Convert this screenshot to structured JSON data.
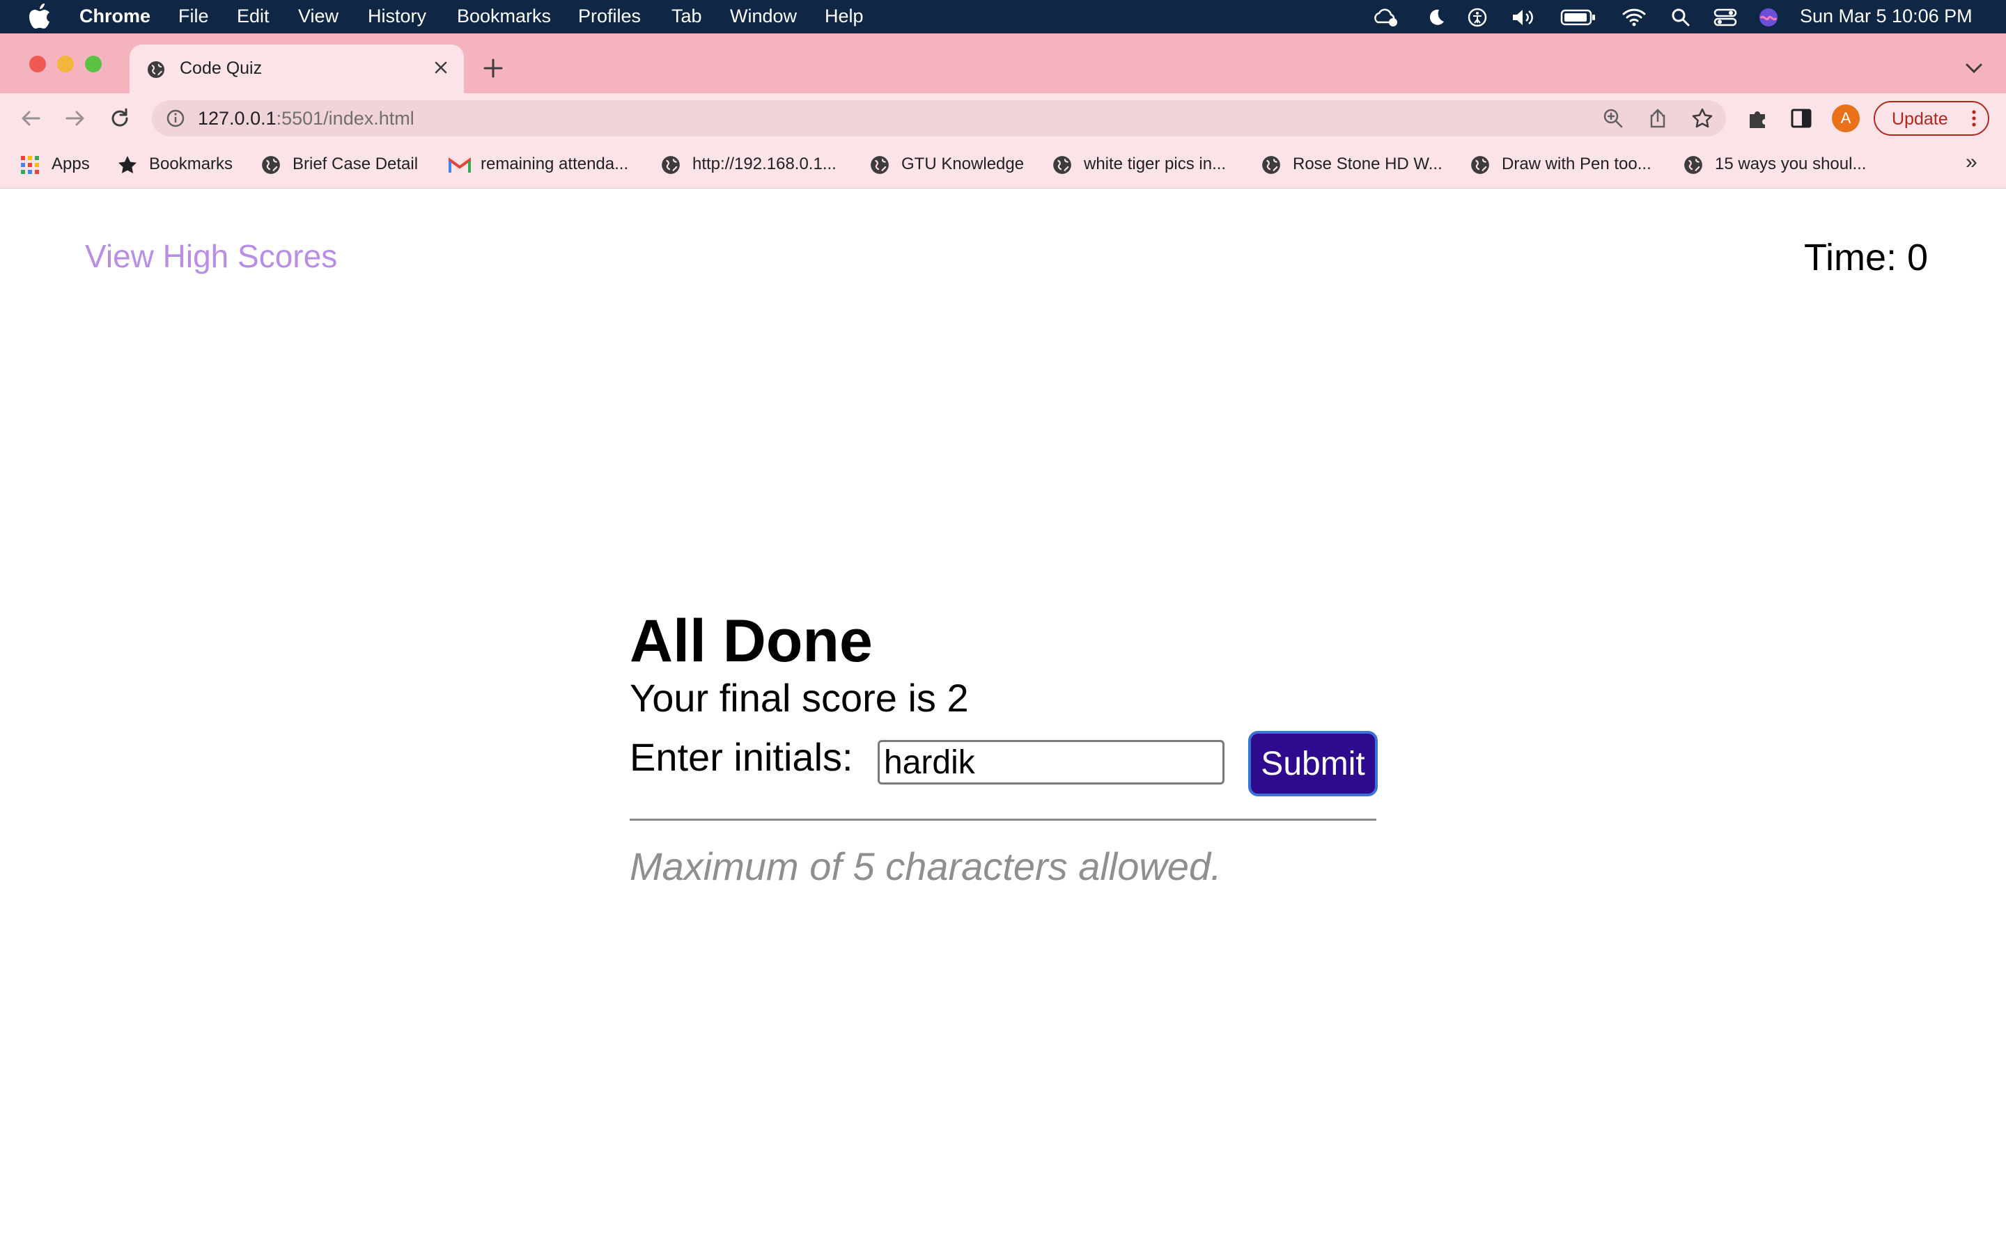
{
  "menubar": {
    "app": "Chrome",
    "items": [
      "File",
      "Edit",
      "View",
      "History",
      "Bookmarks",
      "Profiles",
      "Tab",
      "Window",
      "Help"
    ],
    "datetime": "Sun Mar 5  10:06 PM"
  },
  "browser": {
    "tab_title": "Code Quiz",
    "url_host": "127.0.0.1",
    "url_rest": ":5501/index.html",
    "avatar_letter": "A",
    "update_label": "Update",
    "bookmarks": [
      {
        "label": "Apps",
        "icon": "apps-grid-icon"
      },
      {
        "label": "Bookmarks",
        "icon": "star-icon"
      },
      {
        "label": "Brief Case Detail",
        "icon": "globe-icon"
      },
      {
        "label": "remaining attenda...",
        "icon": "gmail-icon"
      },
      {
        "label": "http://192.168.0.1...",
        "icon": "globe-icon"
      },
      {
        "label": "GTU Knowledge",
        "icon": "globe-icon"
      },
      {
        "label": "white tiger pics in...",
        "icon": "globe-icon"
      },
      {
        "label": "Rose Stone HD W...",
        "icon": "globe-icon"
      },
      {
        "label": "Draw with Pen too...",
        "icon": "globe-icon"
      },
      {
        "label": "15 ways you shoul...",
        "icon": "globe-icon"
      }
    ],
    "more_bookmarks": "»"
  },
  "page": {
    "high_scores_link": "View High Scores",
    "time_label": "Time:",
    "time_value": "0",
    "heading": "All Done",
    "score_text": "Your final score is 2",
    "initials_label": "Enter initials:",
    "initials_value": "hardik",
    "submit_label": "Submit",
    "hint": "Maximum of 5 characters allowed."
  },
  "colors": {
    "menubar": "#0f2645",
    "tabstrip": "#f5b2bf",
    "toolbar": "#fbe3e8",
    "link": "#b98ee6",
    "submit_bg": "#2e0a8e",
    "submit_border": "#3a72d8",
    "hint": "#8f8f8f"
  }
}
